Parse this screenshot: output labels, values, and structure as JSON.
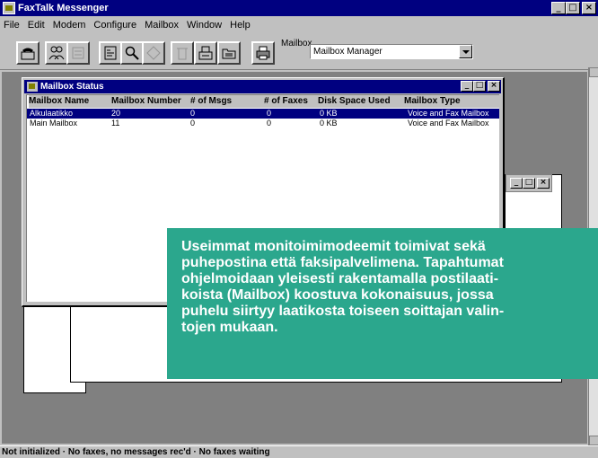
{
  "app": {
    "title": "FaxTalk Messenger"
  },
  "menubar": [
    "File",
    "Edit",
    "Modem",
    "Configure",
    "Mailbox",
    "Window",
    "Help"
  ],
  "toolbar": {
    "buttons": [
      "phone-icon",
      "people-icon",
      "contacts-icon",
      "fax-view-icon",
      "search-icon",
      "tag-icon",
      "trash-icon",
      "fax-machine-icon",
      "folder-icon",
      "printer-icon"
    ],
    "mailbox_label": "Mailbox",
    "mailbox_value": "Mailbox Manager"
  },
  "mailbox_status": {
    "title": "Mailbox Status",
    "columns": [
      "Mailbox Name",
      "Mailbox Number",
      "# of Msgs",
      "# of Faxes",
      "Disk Space Used",
      "Mailbox Type"
    ],
    "rows": [
      [
        "Alkulaatikko",
        "20",
        "0",
        "0",
        "0 KB",
        "Voice and Fax Mailbox"
      ],
      [
        "Main Mailbox",
        "11",
        "0",
        "0",
        "0 KB",
        "Voice and Fax Mailbox"
      ]
    ]
  },
  "callout": {
    "text": "Useimmat monitoimimodeemit toimivat sekä\npuhepostina että faksipalvelimena. Tapahtumat\nohjelmoidaan yleisesti rakentamalla postilaati-\nkoista (Mailbox) koostuva kokonaisuus, jossa\npuhelu siirtyy laatikosta toiseen soittajan valin-\ntojen mukaan."
  },
  "status_bar": "Not initialized · No faxes, no messages rec'd · No faxes waiting",
  "colors": {
    "titlebar": "#000080",
    "callout": "#2ba78d",
    "selection": "#000080"
  }
}
